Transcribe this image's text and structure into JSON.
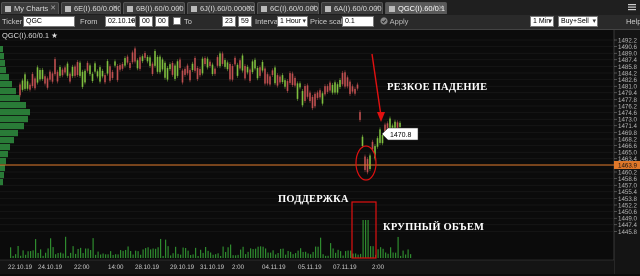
{
  "tabs": [
    {
      "label": "My Charts",
      "active": false
    },
    {
      "label": "6E(I).60/0.0001",
      "active": false
    },
    {
      "label": "6B(I).60/0.0001",
      "active": false
    },
    {
      "label": "6J(I).60/0.000001",
      "active": false
    },
    {
      "label": "6C(I).60/0.0001",
      "active": false
    },
    {
      "label": "6A(I).60/0.0001",
      "active": false
    },
    {
      "label": "QGC(I).60/0.1",
      "active": true
    }
  ],
  "toolbar": {
    "ticker_label": "Ticker",
    "ticker_value": "QGC",
    "from_label": "From",
    "from_date": "02.10.19",
    "from_hour": "00",
    "from_min": "00",
    "to_label": "To",
    "to_hour": "23",
    "to_min": "59",
    "interval_label": "Interval",
    "interval_value": "1 Hour",
    "price_scale_label": "Price scale",
    "price_scale_value": "0.1",
    "apply_label": "Apply",
    "timeframe_value": "1 Min",
    "side_value": "Buy+Sell",
    "help_label": "Help"
  },
  "chart": {
    "symbol_title": "QGC(I).60/0.1 ★",
    "price_levels": [
      "1492.2",
      "1490.6",
      "1489.0",
      "1487.4",
      "1485.8",
      "1484.2",
      "1482.6",
      "1481.0",
      "1479.4",
      "1477.8",
      "1476.2",
      "1474.6",
      "1473.0",
      "1471.4",
      "1469.8",
      "1468.2",
      "1466.6",
      "1465.0",
      "1463.4",
      "1461.8",
      "1460.2",
      "1458.6",
      "1457.0",
      "1455.4",
      "1453.8",
      "1452.2",
      "1450.6",
      "1449.0",
      "1447.4",
      "1445.8"
    ],
    "price_bubble": "1470.8",
    "support_price": "1463.9",
    "time_labels": [
      "22.10.19",
      "24.10.19",
      "22:00",
      "14:00",
      "28.10.19",
      "29.10.19",
      "31.10.19",
      "2:00",
      "04.11.19",
      "05.11.19",
      "07.11.19",
      "2:00"
    ],
    "annotations": {
      "sharp_drop": "РЕЗКОЕ ПАДЕНИЕ",
      "support": "ПОДДЕРЖКА",
      "large_volume": "КРУПНЫЙ ОБЪЕМ"
    },
    "colors": {
      "background": "#0b0b0b",
      "candle_up": "#7fbf3f",
      "candle_down": "#c05050",
      "volume": "#2e8b2e",
      "support_line": "#e0782a",
      "annotation_marker": "#e01010"
    }
  }
}
